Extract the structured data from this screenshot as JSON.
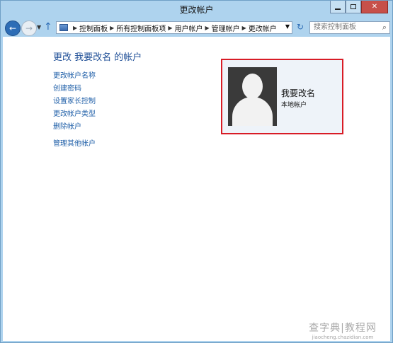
{
  "window": {
    "title": "更改帐户"
  },
  "navigation": {
    "breadcrumbs": [
      "控制面板",
      "所有控制面板项",
      "用户帐户",
      "管理帐户",
      "更改帐户"
    ],
    "search_placeholder": "搜索控制面板",
    "icons": {
      "back": "back-arrow-icon",
      "forward": "forward-arrow-icon",
      "up": "up-arrow-icon",
      "refresh": "refresh-icon",
      "search": "search-icon"
    }
  },
  "main": {
    "heading": "更改 我要改名 的帐户",
    "tasks": [
      "更改帐户名称",
      "创建密码",
      "设置家长控制",
      "更改帐户类型",
      "删除帐户"
    ],
    "other_task": "管理其他帐户"
  },
  "account": {
    "name": "我要改名",
    "type": "本地帐户",
    "highlight_color": "#d81c26"
  },
  "watermark": {
    "main": "查字典|教程网",
    "sub": "jiaocheng.chazidian.com"
  },
  "colors": {
    "frame": "#aed3ee",
    "link": "#1f5fa8",
    "heading": "#1e4e96"
  }
}
